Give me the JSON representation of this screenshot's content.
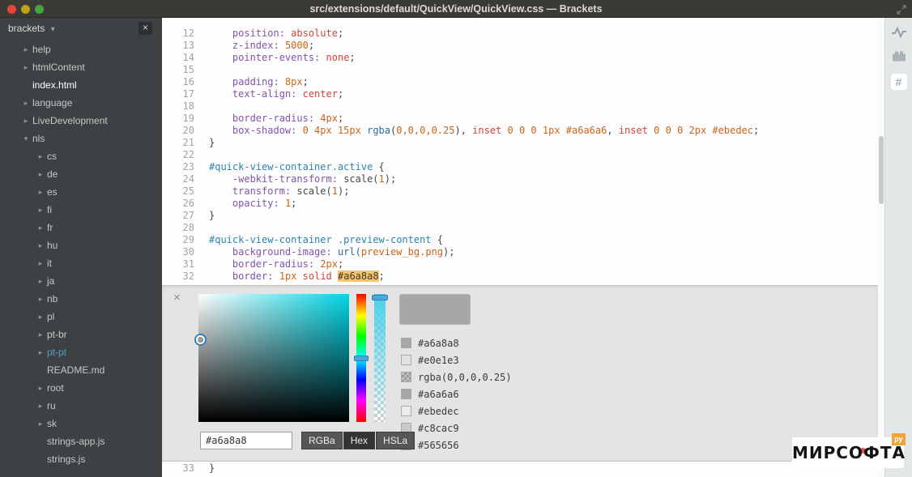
{
  "window": {
    "title": "src/extensions/default/QuickView/QuickView.css — Brackets",
    "buttons": [
      {
        "name": "close",
        "color": "#e24738"
      },
      {
        "name": "minimize",
        "color": "#b9a11c"
      },
      {
        "name": "maximize",
        "color": "#44a73e"
      }
    ]
  },
  "sidebar": {
    "project_name": "brackets",
    "dropdown_glyph": "▾",
    "close_glyph": "×",
    "items": [
      {
        "label": "help",
        "type": "folder",
        "indent": 0
      },
      {
        "label": "htmlContent",
        "type": "folder",
        "indent": 0
      },
      {
        "label": "index.html",
        "type": "file",
        "indent": 0,
        "state": "active"
      },
      {
        "label": "language",
        "type": "folder",
        "indent": 0
      },
      {
        "label": "LiveDevelopment",
        "type": "folder",
        "indent": 0
      },
      {
        "label": "nls",
        "type": "folder-open",
        "indent": 0
      },
      {
        "label": "cs",
        "type": "folder",
        "indent": 1
      },
      {
        "label": "de",
        "type": "folder",
        "indent": 1
      },
      {
        "label": "es",
        "type": "folder",
        "indent": 1
      },
      {
        "label": "fi",
        "type": "folder",
        "indent": 1
      },
      {
        "label": "fr",
        "type": "folder",
        "indent": 1
      },
      {
        "label": "hu",
        "type": "folder",
        "indent": 1
      },
      {
        "label": "it",
        "type": "folder",
        "indent": 1
      },
      {
        "label": "ja",
        "type": "folder",
        "indent": 1
      },
      {
        "label": "nb",
        "type": "folder",
        "indent": 1
      },
      {
        "label": "pl",
        "type": "folder",
        "indent": 1
      },
      {
        "label": "pt-br",
        "type": "folder",
        "indent": 1
      },
      {
        "label": "pt-pt",
        "type": "folder",
        "indent": 1,
        "state": "accent"
      },
      {
        "label": "README.md",
        "type": "file",
        "indent": 1
      },
      {
        "label": "root",
        "type": "folder",
        "indent": 1
      },
      {
        "label": "ru",
        "type": "folder",
        "indent": 1
      },
      {
        "label": "sk",
        "type": "folder",
        "indent": 1
      },
      {
        "label": "strings-app.js",
        "type": "file",
        "indent": 1
      },
      {
        "label": "strings.js",
        "type": "file",
        "indent": 1
      }
    ]
  },
  "editor": {
    "lines": [
      {
        "n": 12,
        "s": [
          [
            "    position:",
            "prop"
          ],
          [
            " ",
            "p"
          ],
          [
            "absolute",
            "val"
          ],
          [
            ";",
            "p"
          ]
        ]
      },
      {
        "n": 13,
        "s": [
          [
            "    z-index:",
            "prop"
          ],
          [
            " ",
            "p"
          ],
          [
            "5000",
            "num"
          ],
          [
            ";",
            "p"
          ]
        ]
      },
      {
        "n": 14,
        "s": [
          [
            "    pointer-events:",
            "prop"
          ],
          [
            " ",
            "p"
          ],
          [
            "none",
            "val"
          ],
          [
            ";",
            "p"
          ]
        ]
      },
      {
        "n": 15,
        "s": []
      },
      {
        "n": 16,
        "s": [
          [
            "    padding:",
            "prop"
          ],
          [
            " ",
            "p"
          ],
          [
            "8px",
            "num"
          ],
          [
            ";",
            "p"
          ]
        ]
      },
      {
        "n": 17,
        "s": [
          [
            "    text-align:",
            "prop"
          ],
          [
            " ",
            "p"
          ],
          [
            "center",
            "val"
          ],
          [
            ";",
            "p"
          ]
        ]
      },
      {
        "n": 18,
        "s": []
      },
      {
        "n": 19,
        "s": [
          [
            "    border-radius:",
            "prop"
          ],
          [
            " ",
            "p"
          ],
          [
            "4px",
            "num"
          ],
          [
            ";",
            "p"
          ]
        ]
      },
      {
        "n": 20,
        "s": [
          [
            "    box-shadow:",
            "prop"
          ],
          [
            " ",
            "p"
          ],
          [
            "0 4px 15px ",
            "num"
          ],
          [
            "rgba",
            "fn"
          ],
          [
            "(",
            "p"
          ],
          [
            "0,0,0,0.25",
            "num"
          ],
          [
            ")",
            "p"
          ],
          [
            ", ",
            "p"
          ],
          [
            "inset",
            "val"
          ],
          [
            " ",
            "p"
          ],
          [
            "0 0 0 1px ",
            "num"
          ],
          [
            "#a6a6a6",
            "num"
          ],
          [
            ", ",
            "p"
          ],
          [
            "inset",
            "val"
          ],
          [
            " ",
            "p"
          ],
          [
            "0 0 0 2px ",
            "num"
          ],
          [
            "#ebedec",
            "num"
          ],
          [
            ";",
            "p"
          ]
        ]
      },
      {
        "n": 21,
        "s": [
          [
            "}",
            "p"
          ]
        ]
      },
      {
        "n": 22,
        "s": []
      },
      {
        "n": 23,
        "s": [
          [
            "#quick-view-container.active",
            "sel"
          ],
          [
            " {",
            "p"
          ]
        ]
      },
      {
        "n": 24,
        "s": [
          [
            "    -webkit-transform:",
            "prop"
          ],
          [
            " ",
            "p"
          ],
          [
            "scale(",
            "p"
          ],
          [
            "1",
            "num"
          ],
          [
            ");",
            "p"
          ]
        ]
      },
      {
        "n": 25,
        "s": [
          [
            "    transform:",
            "prop"
          ],
          [
            " ",
            "p"
          ],
          [
            "scale(",
            "p"
          ],
          [
            "1",
            "num"
          ],
          [
            ");",
            "p"
          ]
        ]
      },
      {
        "n": 26,
        "s": [
          [
            "    opacity:",
            "prop"
          ],
          [
            " ",
            "p"
          ],
          [
            "1",
            "num"
          ],
          [
            ";",
            "p"
          ]
        ]
      },
      {
        "n": 27,
        "s": [
          [
            "}",
            "p"
          ]
        ]
      },
      {
        "n": 28,
        "s": []
      },
      {
        "n": 29,
        "s": [
          [
            "#quick-view-container .preview-content",
            "sel"
          ],
          [
            " {",
            "p"
          ]
        ]
      },
      {
        "n": 30,
        "s": [
          [
            "    background-image:",
            "prop"
          ],
          [
            " ",
            "p"
          ],
          [
            "url(",
            "fn"
          ],
          [
            "preview_bg.png",
            "num"
          ],
          [
            ");",
            "p"
          ]
        ]
      },
      {
        "n": 31,
        "s": [
          [
            "    border-radius:",
            "prop"
          ],
          [
            " ",
            "p"
          ],
          [
            "2px",
            "num"
          ],
          [
            ";",
            "p"
          ]
        ]
      },
      {
        "n": 32,
        "s": [
          [
            "    border:",
            "prop"
          ],
          [
            " ",
            "p"
          ],
          [
            "1px",
            "num"
          ],
          [
            " ",
            "p"
          ],
          [
            "solid",
            "val"
          ],
          [
            " ",
            "p"
          ],
          [
            "#a6a8a8",
            "hl"
          ],
          [
            ";",
            "p"
          ]
        ]
      }
    ],
    "bottom_line": {
      "n": 33,
      "s": [
        [
          "}",
          "p"
        ]
      ]
    }
  },
  "picker": {
    "close_glyph": "×",
    "current_color": "#a6a8a8",
    "input_value": "#a6a8a8",
    "buttons": [
      "RGBa",
      "Hex",
      "HSLa"
    ],
    "active_button": "Hex",
    "swatches": [
      {
        "label": "#a6a8a8",
        "color": "#a6a8a8"
      },
      {
        "label": "#e0e1e3",
        "color": "#e0e1e3"
      },
      {
        "label": "rgba(0,0,0,0.25)",
        "color": "rgba(0,0,0,0.25)",
        "alpha": true
      },
      {
        "label": "#a6a6a6",
        "color": "#a6a6a6"
      },
      {
        "label": "#ebedec",
        "color": "#ebedec"
      },
      {
        "label": "#c8cac9",
        "color": "#c8cac9"
      },
      {
        "label": "#565656",
        "color": "#565656"
      }
    ]
  },
  "right_toolbar": {
    "icons": [
      "live-preview",
      "extension-manager",
      "color-hash"
    ],
    "hash_glyph": "#"
  },
  "watermark": {
    "text": "МИРСОФТА",
    "badge": "ру"
  }
}
